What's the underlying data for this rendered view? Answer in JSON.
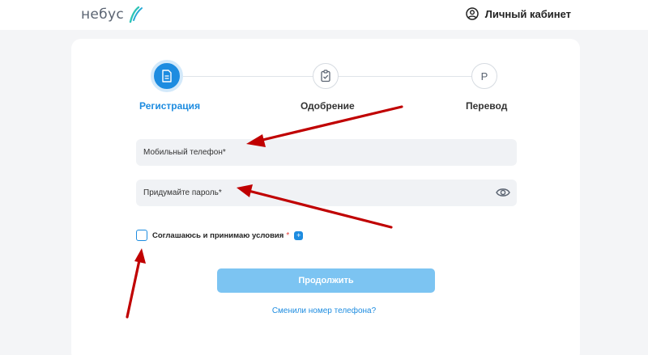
{
  "header": {
    "logo_text": "небус",
    "account_label": "Личный кабинет"
  },
  "stepper": {
    "steps": [
      {
        "label": "Регистрация",
        "state": "active",
        "icon": "document-icon"
      },
      {
        "label": "Одобрение",
        "state": "pending",
        "icon": "clipboard-check-icon"
      },
      {
        "label": "Перевод",
        "state": "pending",
        "letter": "P"
      }
    ]
  },
  "form": {
    "phone_placeholder": "Мобильный телефон*",
    "password_placeholder": "Придумайте пароль*",
    "terms_label": "Соглашаюсь и принимаю условия",
    "required_mark": "*",
    "plus_badge": "+",
    "continue_label": "Продолжить",
    "change_phone_link": "Сменили номер телефона?"
  },
  "colors": {
    "accent": "#1d8ce0",
    "button_disabled": "#7cc4f2",
    "annotation_arrow": "#c00000",
    "background": "#f4f5f7"
  }
}
